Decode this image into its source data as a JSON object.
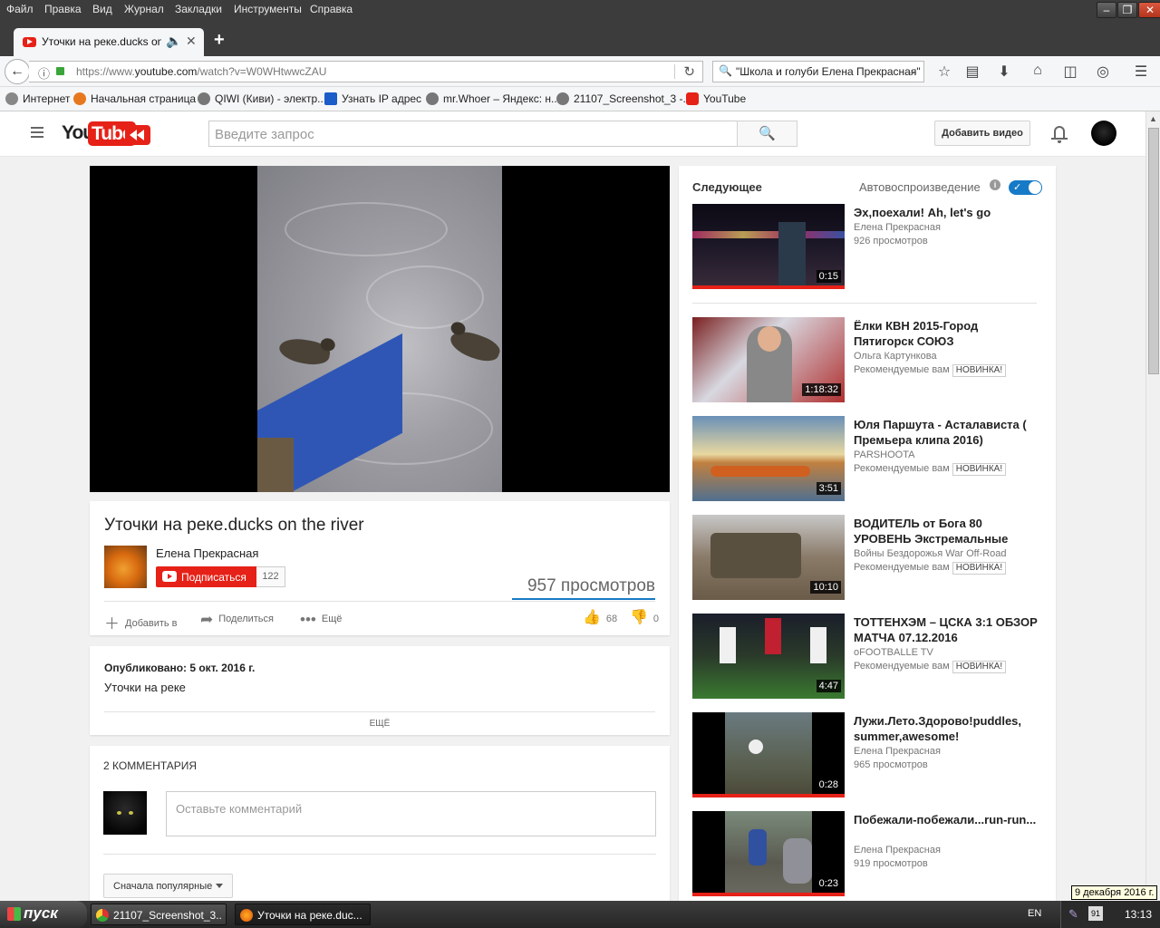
{
  "menu": [
    "Файл",
    "Правка",
    "Вид",
    "Журнал",
    "Закладки",
    "Инструменты",
    "Справка"
  ],
  "tab": {
    "title": "Уточки на реке.ducks on..."
  },
  "address": {
    "prefix": "https://www.",
    "host": "youtube.com",
    "path": "/watch?v=W0WHtwwcZAU"
  },
  "browser_search": {
    "query": "\"Школа и голуби Елена Прекрасная\""
  },
  "bookmarks": [
    "Интернет",
    "Начальная страница",
    "QIWI (Киви) - электр...",
    "Узнать IP адрес",
    "mr.Whoer – Яндекс: н...",
    "21107_Screenshot_3 -...",
    "YouTube"
  ],
  "yt": {
    "logo_you": "You",
    "logo_tube": "Tube",
    "search_placeholder": "Введите запрос",
    "upload": "Добавить видео"
  },
  "video": {
    "title": "Уточки на реке.ducks on the river",
    "channel": "Елена Прекрасная",
    "subscribe": "Подписаться",
    "subscribers": "122",
    "views": "957 просмотров",
    "add_to": "Добавить в",
    "share": "Поделиться",
    "more": "Ещё",
    "likes": "68",
    "dislikes": "0",
    "published": "Опубликовано: 5 окт. 2016 г.",
    "description": "Уточки на реке",
    "show_more": "ЕЩЁ"
  },
  "comments": {
    "header": "2 КОММЕНТАРИЯ",
    "placeholder": "Оставьте комментарий",
    "sort": "Сначала популярные"
  },
  "sidebar": {
    "up_next": "Следующее",
    "autoplay": "Автовоспроизведение",
    "items": [
      {
        "title": "Эх,поехали! Ah, let's go",
        "channel": "Елена Прекрасная",
        "meta": "926 просмотров",
        "badge": "",
        "duration": "0:15"
      },
      {
        "title": "Ёлки КВН 2015-Город Пятигорск СОЮЗ",
        "channel": "Ольга Картункова",
        "meta": "Рекомендуемые вам",
        "badge": "НОВИНКА!",
        "duration": "1:18:32"
      },
      {
        "title": "Юля Паршута - Асталависта ( Премьера клипа 2016)",
        "channel": "PARSHOOTA",
        "meta": "Рекомендуемые вам",
        "badge": "НОВИНКА!",
        "duration": "3:51"
      },
      {
        "title": "ВОДИТЕЛЬ от Бога 80 УРОВЕНЬ Экстремальные",
        "channel": "Войны Бездорожья War Off-Road",
        "meta": "Рекомендуемые вам",
        "badge": "НОВИНКА!",
        "duration": "10:10"
      },
      {
        "title": "ТОТТЕНХЭМ – ЦСКА 3:1 ОБЗОР МАТЧА 07.12.2016",
        "channel": "oFOOTBALLE TV",
        "meta": "Рекомендуемые вам",
        "badge": "НОВИНКА!",
        "duration": "4:47"
      },
      {
        "title": "Лужи.Лето.Здорово!puddles, summer,awesome!",
        "channel": "Елена Прекрасная",
        "meta": "965 просмотров",
        "badge": "",
        "duration": "0:28"
      },
      {
        "title": "Побежали-побежали...run-run...",
        "channel": "Елена Прекрасная",
        "meta": "919 просмотров",
        "badge": "",
        "duration": "0:23"
      }
    ]
  },
  "taskbar": {
    "start": "пуск",
    "tasks": [
      "21107_Screenshot_3...",
      "Уточки на реке.duc..."
    ],
    "lang": "EN",
    "volume": "91",
    "clock": "13:13",
    "date_tooltip": "9 декабря 2016 г."
  },
  "colors": {
    "youtube_red": "#e62117",
    "accent_blue": "#167ac6"
  }
}
